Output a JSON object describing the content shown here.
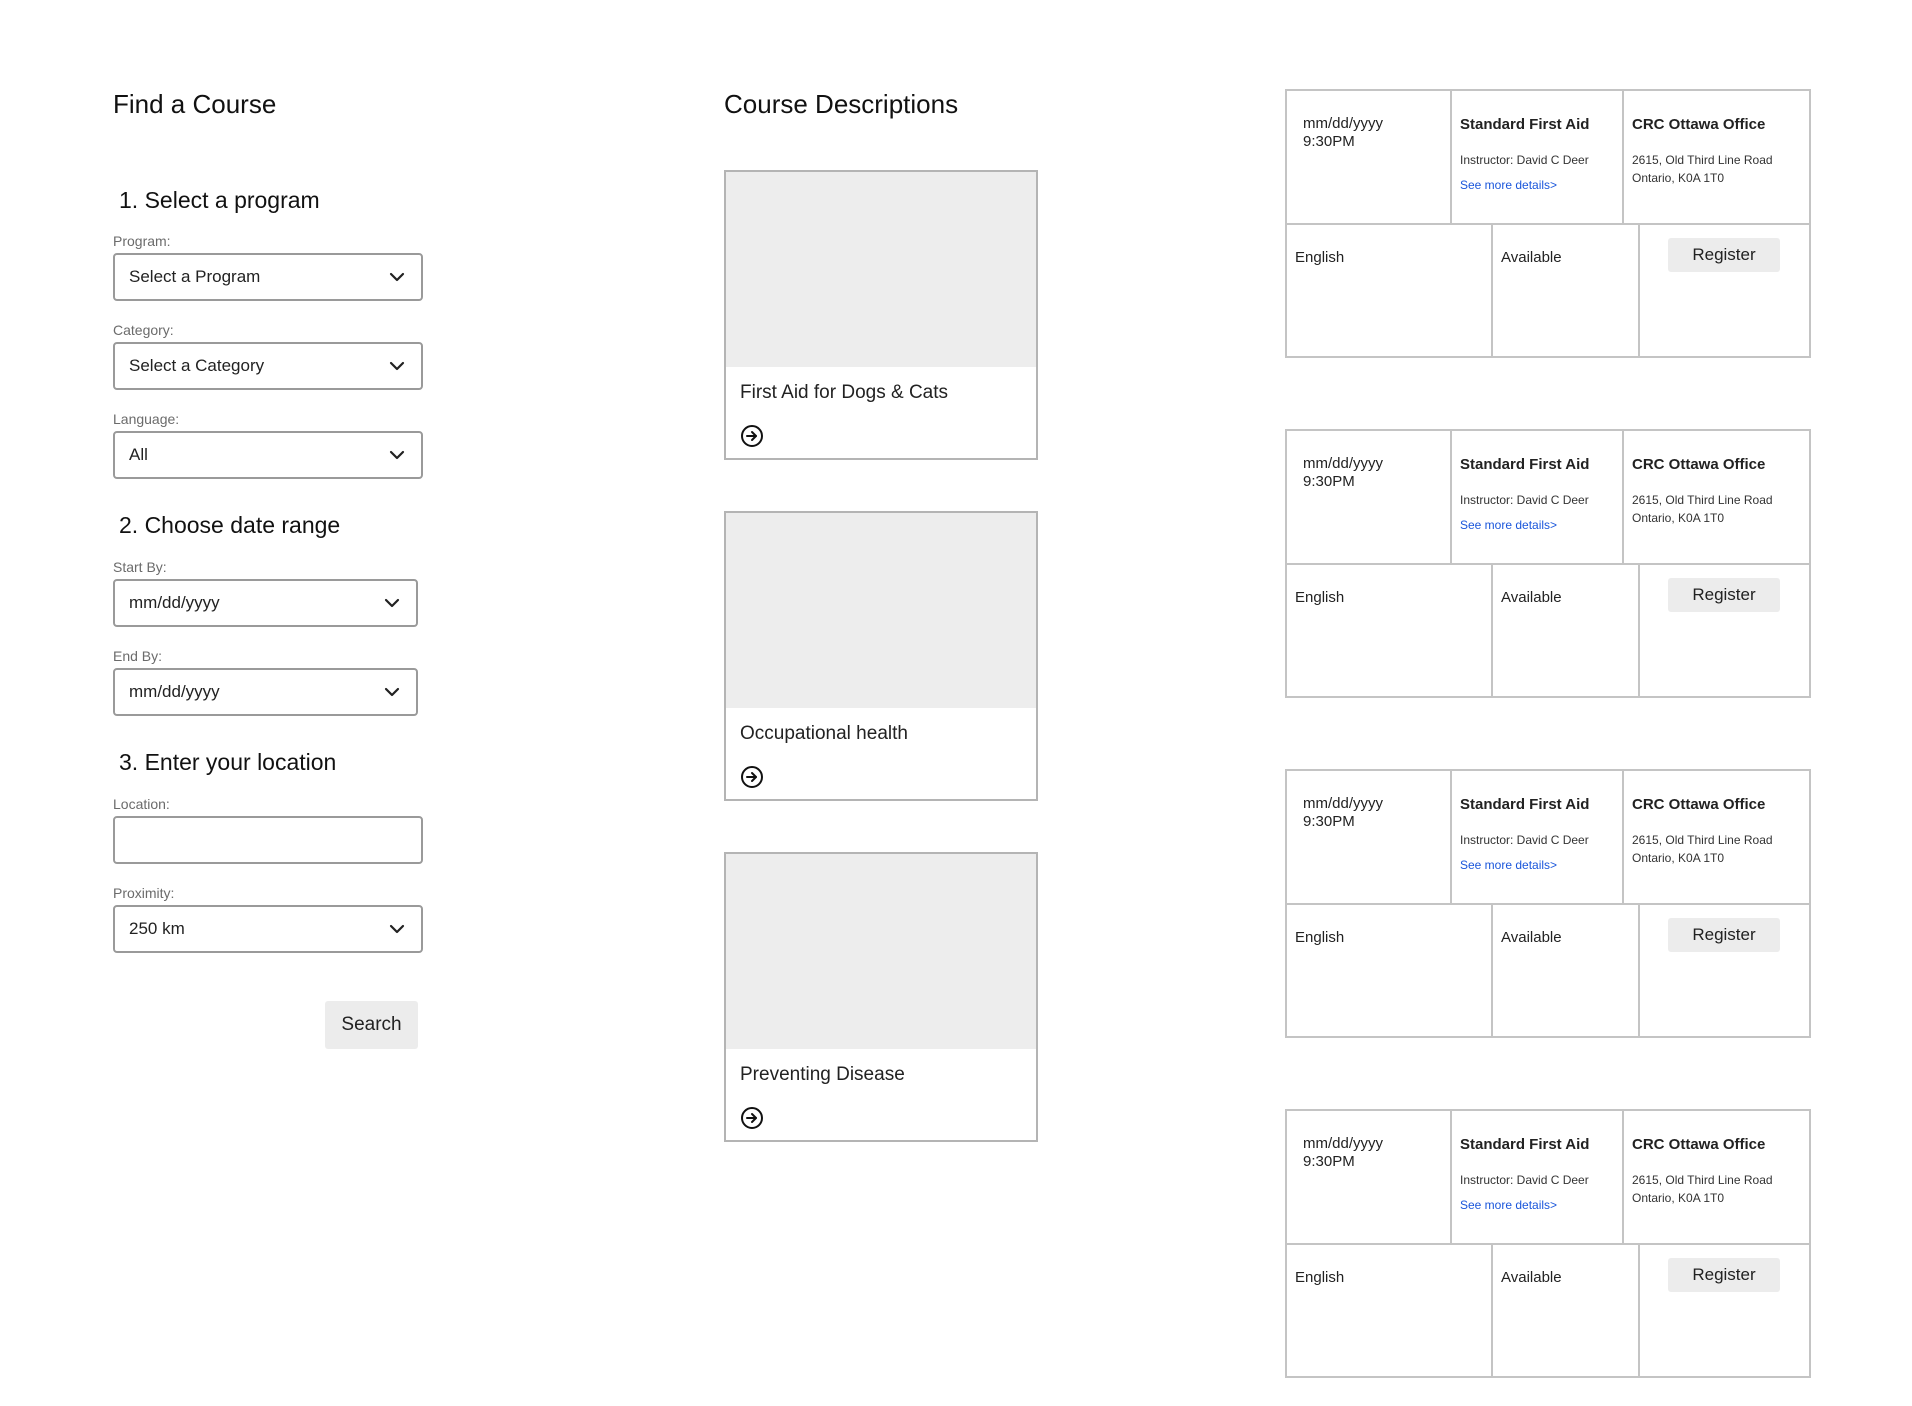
{
  "find": {
    "title": "Find a Course",
    "step1": "1. Select a program",
    "program_label": "Program:",
    "program_value": "Select a Program",
    "category_label": "Category:",
    "category_value": "Select a Category",
    "language_label": "Language:",
    "language_value": "All",
    "step2": "2. Choose date range",
    "start_label": "Start By:",
    "start_value": "mm/dd/yyyy",
    "end_label": "End By:",
    "end_value": "mm/dd/yyyy",
    "step3": "3. Enter your location",
    "location_label": "Location:",
    "location_value": "",
    "proximity_label": "Proximity:",
    "proximity_value": "250 km",
    "search_label": "Search"
  },
  "descriptions": {
    "title": "Course Descriptions",
    "courses": [
      {
        "name": "First Aid for Dogs & Cats",
        "icon": "arrow-circle-right-icon"
      },
      {
        "name": "Occupational health",
        "icon": "arrow-circle-right-icon"
      },
      {
        "name": "Preventing Disease",
        "icon": "arrow-circle-right-icon"
      }
    ]
  },
  "sessions": [
    {
      "date": "mm/dd/yyyy",
      "time": "9:30PM",
      "course": "Standard First Aid",
      "instructor": "Instructor: David C Deer",
      "details": "See more details>",
      "office": "CRC Ottawa Office",
      "address1": "2615, Old Third Line Road",
      "address2": "Ontario, K0A 1T0",
      "language": "English",
      "status": "Available",
      "register": "Register"
    },
    {
      "date": "mm/dd/yyyy",
      "time": "9:30PM",
      "course": "Standard First Aid",
      "instructor": "Instructor: David C Deer",
      "details": "See more details>",
      "office": "CRC Ottawa Office",
      "address1": "2615, Old Third Line Road",
      "address2": "Ontario, K0A 1T0",
      "language": "English",
      "status": "Available",
      "register": "Register"
    },
    {
      "date": "mm/dd/yyyy",
      "time": "9:30PM",
      "course": "Standard First Aid",
      "instructor": "Instructor: David C Deer",
      "details": "See more details>",
      "office": "CRC Ottawa Office",
      "address1": "2615, Old Third Line Road",
      "address2": "Ontario, K0A 1T0",
      "language": "English",
      "status": "Available",
      "register": "Register"
    },
    {
      "date": "mm/dd/yyyy",
      "time": "9:30PM",
      "course": "Standard First Aid",
      "instructor": "Instructor: David C Deer",
      "details": "See more details>",
      "office": "CRC Ottawa Office",
      "address1": "2615, Old Third Line Road",
      "address2": "Ontario, K0A 1T0",
      "language": "English",
      "status": "Available",
      "register": "Register"
    }
  ],
  "colors": {
    "link": "#1a56db",
    "placeholder_fill": "#ededed",
    "button_fill": "#ececec"
  }
}
